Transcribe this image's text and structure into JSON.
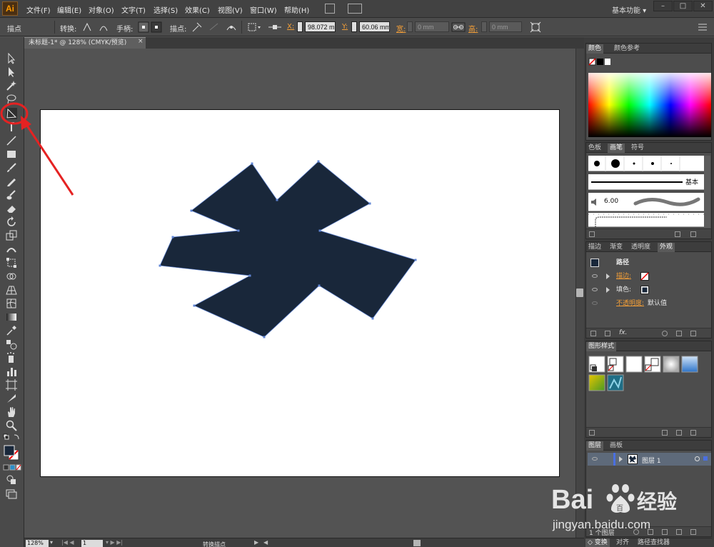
{
  "app": {
    "logo": "Ai",
    "menu": [
      "文件(F)",
      "编辑(E)",
      "对象(O)",
      "文字(T)",
      "选择(S)",
      "效果(C)",
      "视图(V)",
      "窗口(W)",
      "帮助(H)"
    ],
    "workspace": "基本功能",
    "win_buttons": [
      "–",
      "□",
      "✕"
    ]
  },
  "controlbar": {
    "mode": "描点",
    "convert_label": "转换:",
    "handle_label": "手柄:",
    "anchor_label": "描点:",
    "x_label": "X:",
    "x_value": "98.072 mm",
    "y_label": "Y:",
    "y_value": "60.06 mm",
    "w_label": "宽:",
    "w_value": "0 mm",
    "h_label": "高:",
    "h_value": "0 mm"
  },
  "document": {
    "tab_title": "未标题-1* @ 128% (CMYK/预览)",
    "tab_close": "×"
  },
  "status": {
    "zoom": "128%",
    "page": "1",
    "tool": "转换描点"
  },
  "panels": {
    "color_tabs": [
      "颜色",
      "颜色参考"
    ],
    "brush_tabs": [
      "色板",
      "画笔",
      "符号"
    ],
    "brush_basic": "基本",
    "brush_size": "6.00",
    "appearance_tabs": [
      "描边",
      "渐变",
      "透明度",
      "外观"
    ],
    "appearance_title": "路径",
    "stroke_label": "描边:",
    "fill_label": "填色:",
    "opacity_label": "不透明度:",
    "opacity_value": "默认值",
    "fx": "fx.",
    "styles_tabs": [
      "图形样式"
    ],
    "layers_tabs": [
      "图层",
      "画板"
    ],
    "layer_name": "图层 1",
    "layer_count": "1 个图层",
    "bottom_tabs": [
      "变换",
      "对齐",
      "路径查找器"
    ]
  },
  "colors": {
    "shape_fill": "#19273a",
    "anchor_stroke": "#5f84d4",
    "annotation": "#e52222"
  },
  "watermark": {
    "brand": "Bai",
    "brand2": "百",
    "cn": "经验",
    "url": "jingyan.baidu.com"
  }
}
